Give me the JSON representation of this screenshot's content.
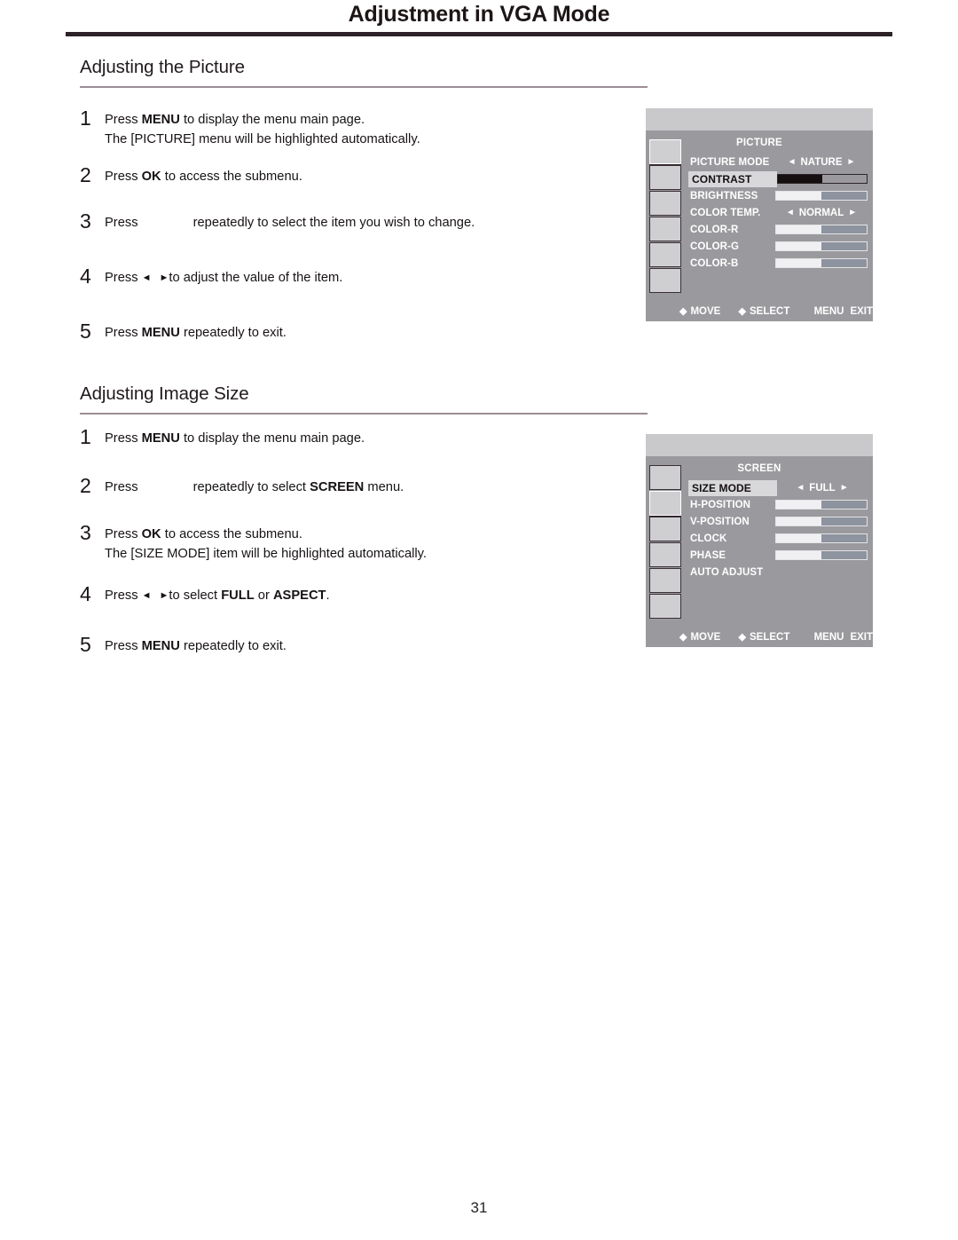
{
  "document": {
    "title": "Adjustment in VGA Mode",
    "page_number": "31"
  },
  "sections": [
    {
      "heading": "Adjusting the Picture",
      "steps": [
        {
          "num": "1",
          "line1_a": "Press ",
          "line1_b": "MENU",
          "line1_c": " to display the menu main page.",
          "line2": "The [PICTURE] menu will be highlighted automatically."
        },
        {
          "num": "2",
          "line1_a": "Press ",
          "line1_b": "OK",
          "line1_c": " to access the submenu."
        },
        {
          "num": "3",
          "line1_a": "Press ",
          "line1_c": "repeatedly to select the item you wish to change."
        },
        {
          "num": "4",
          "line1_a": "Press ",
          "line1_c": "to adjust the value of the item."
        },
        {
          "num": "5",
          "line1_a": "Press ",
          "line1_b": "MENU",
          "line1_c": " repeatedly to exit."
        }
      ]
    },
    {
      "heading": "Adjusting Image Size",
      "steps": [
        {
          "num": "1",
          "line1_a": "Press ",
          "line1_b": "MENU",
          "line1_c": " to display the menu main page."
        },
        {
          "num": "2",
          "line1_a": "Press ",
          "line1_c": "repeatedly to select ",
          "line1_d": "SCREEN",
          "line1_e": " menu."
        },
        {
          "num": "3",
          "line1_a": "Press ",
          "line1_b": "OK",
          "line1_c": " to access the submenu.",
          "line2": "The [SIZE MODE] item will be highlighted automatically."
        },
        {
          "num": "4",
          "line1_a": "Press ",
          "line1_c": "to select ",
          "line1_d": "FULL",
          "line1_e": " or ",
          "line1_f": "ASPECT",
          "line1_g": "."
        },
        {
          "num": "5",
          "line1_a": "Press ",
          "line1_b": "MENU",
          "line1_c": " repeatedly to exit."
        }
      ]
    }
  ],
  "osd_picture": {
    "title": "PICTURE",
    "rail_selected_index": 0,
    "rail_count": 6,
    "rows": [
      {
        "label": "PICTURE MODE",
        "type": "option",
        "left": "◄",
        "value": "NATURE",
        "right": "►",
        "highlight": false
      },
      {
        "label": "CONTRAST",
        "type": "bar",
        "fill_percent": 50,
        "style": "dark",
        "highlight": true
      },
      {
        "label": "BRIGHTNESS",
        "type": "bar",
        "fill_percent": 50,
        "style": "light",
        "highlight": false
      },
      {
        "label": "COLOR TEMP.",
        "type": "option",
        "left": "◄",
        "value": "NORMAL",
        "right": "►",
        "highlight": false
      },
      {
        "label": "COLOR-R",
        "type": "bar",
        "fill_percent": 50,
        "style": "light",
        "highlight": false
      },
      {
        "label": "COLOR-G",
        "type": "bar",
        "fill_percent": 50,
        "style": "light",
        "highlight": false
      },
      {
        "label": "COLOR-B",
        "type": "bar",
        "fill_percent": 50,
        "style": "light",
        "highlight": false
      }
    ],
    "footer": {
      "move_icon": "◆",
      "move_label": "MOVE",
      "select_icon": "◆",
      "select_label": "SELECT",
      "menu_label": "MENU",
      "exit_label": "EXIT"
    }
  },
  "osd_screen": {
    "title": "SCREEN",
    "rail_selected_index": 1,
    "rail_count": 6,
    "rows": [
      {
        "label": "SIZE MODE",
        "type": "option",
        "left": "◄",
        "value": "FULL",
        "right": "►",
        "highlight": true
      },
      {
        "label": "H-POSITION",
        "type": "bar",
        "fill_percent": 50,
        "style": "light",
        "highlight": false
      },
      {
        "label": "V-POSITION",
        "type": "bar",
        "fill_percent": 50,
        "style": "light",
        "highlight": false
      },
      {
        "label": "CLOCK",
        "type": "bar",
        "fill_percent": 50,
        "style": "light",
        "highlight": false
      },
      {
        "label": "PHASE",
        "type": "bar",
        "fill_percent": 50,
        "style": "light",
        "highlight": false
      },
      {
        "label": "AUTO ADJUST",
        "type": "none",
        "highlight": false
      }
    ],
    "footer": {
      "move_icon": "◆",
      "move_label": "MOVE",
      "select_icon": "◆",
      "select_label": "SELECT",
      "menu_label": "MENU",
      "exit_label": "EXIT"
    }
  },
  "glyphs": {
    "arrow_left": "◄",
    "arrow_right": "►"
  }
}
